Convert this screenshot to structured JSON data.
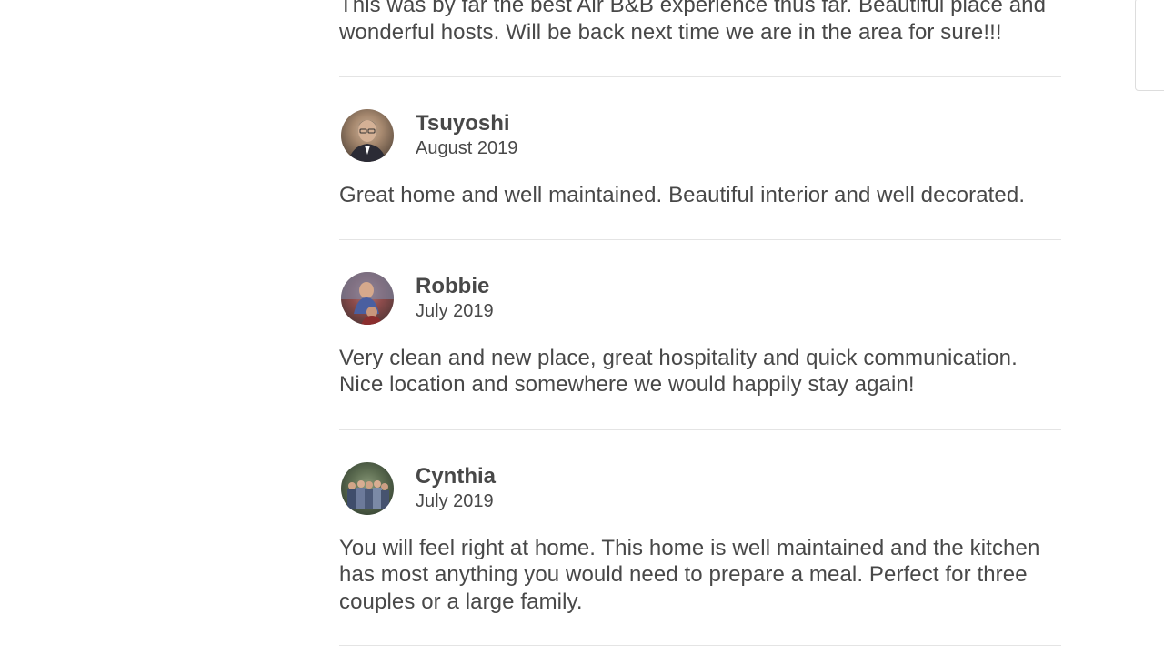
{
  "intro_review": {
    "text": "This was by far the best Air B&B experience thus far. Beautiful place and wonderful hosts. Will be back next time we are in the area for sure!!!"
  },
  "reviews": [
    {
      "name": "Tsuyoshi",
      "date": "August 2019",
      "avatar_icon": "user-avatar-photo",
      "text": "Great home and well maintained. Beautiful interior and well decorated."
    },
    {
      "name": "Robbie",
      "date": "July 2019",
      "avatar_icon": "user-avatar-photo",
      "text": "Very clean and new place, great hospitality and quick communication. Nice location and somewhere we would happily stay again!"
    },
    {
      "name": "Cynthia",
      "date": "July 2019",
      "avatar_icon": "user-avatar-photo",
      "text": "You will feel right at home. This home is well maintained and the kitchen has most anything you would need to prepare a meal. Perfect for three couples or a large family."
    }
  ],
  "colors": {
    "text": "#484848",
    "divider": "#e4e4e4",
    "background": "#ffffff"
  }
}
